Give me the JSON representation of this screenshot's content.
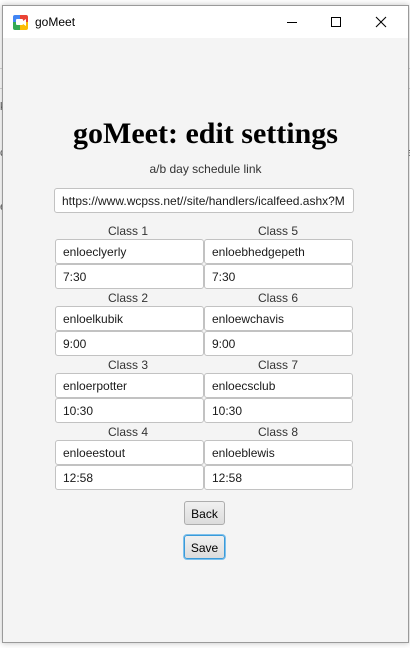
{
  "window": {
    "title": "goMeet"
  },
  "header": {
    "title": "goMeet: edit settings",
    "link_label": "a/b day schedule link"
  },
  "link_field": {
    "value": "https://www.wcpss.net//site/handlers/icalfeed.ashx?M"
  },
  "classes": [
    {
      "label": "Class 1",
      "name": "enloeclyerly",
      "time": "7:30"
    },
    {
      "label": "Class 2",
      "name": "enloelkubik",
      "time": "9:00"
    },
    {
      "label": "Class 3",
      "name": "enloerpotter",
      "time": "10:30"
    },
    {
      "label": "Class 4",
      "name": "enloeestout",
      "time": "12:58"
    },
    {
      "label": "Class 5",
      "name": "enloebhedgepeth",
      "time": "7:30"
    },
    {
      "label": "Class 6",
      "name": "enloewchavis",
      "time": "9:00"
    },
    {
      "label": "Class 7",
      "name": "enloecsclub",
      "time": "10:30"
    },
    {
      "label": "Class 8",
      "name": "enloeblewis",
      "time": "12:58"
    }
  ],
  "buttons": {
    "back": "Back",
    "save": "Save"
  },
  "icons": {
    "app": "gomeet-logo-icon",
    "minimize": "minimize-icon",
    "maximize": "maximize-icon",
    "close": "close-icon"
  },
  "colors": {
    "focus_accent": "#3a9ad9"
  },
  "background_app": {
    "fragments": [
      "k",
      "c",
      "e",
      "da"
    ]
  }
}
